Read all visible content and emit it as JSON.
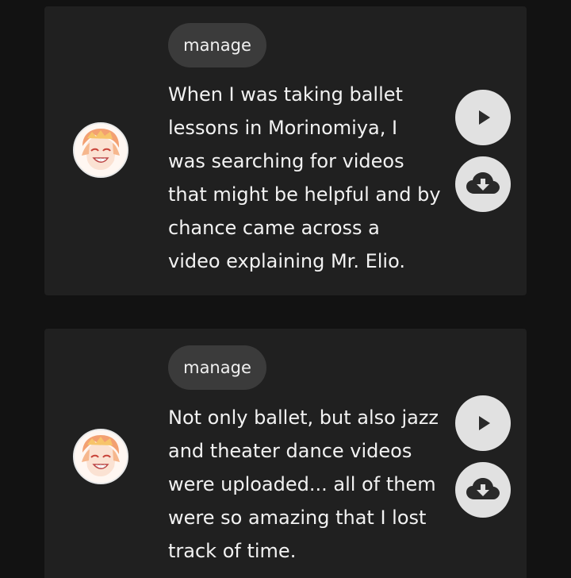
{
  "icons": {
    "avatar": "character-avatar",
    "play": "play-icon",
    "download": "cloud-download-icon"
  },
  "colors": {
    "background": "#121212",
    "card": "#202020",
    "chip": "#3b3b3b",
    "button": "#e1e1e1",
    "icon": "#2a2a2a",
    "text": "#f2f2f2"
  },
  "messages": [
    {
      "chip_label": "manage",
      "text_lines": [
        "When I was taking ballet",
        "lessons in Morinomiya, I",
        "was searching for videos",
        "that might be helpful and by",
        "chance came across a",
        "video explaining Mr. Elio."
      ]
    },
    {
      "chip_label": "manage",
      "text_lines": [
        "Not only ballet, but also jazz",
        "and theater dance videos",
        "were uploaded... all of them",
        "were so amazing that I lost",
        "track of time."
      ]
    }
  ]
}
